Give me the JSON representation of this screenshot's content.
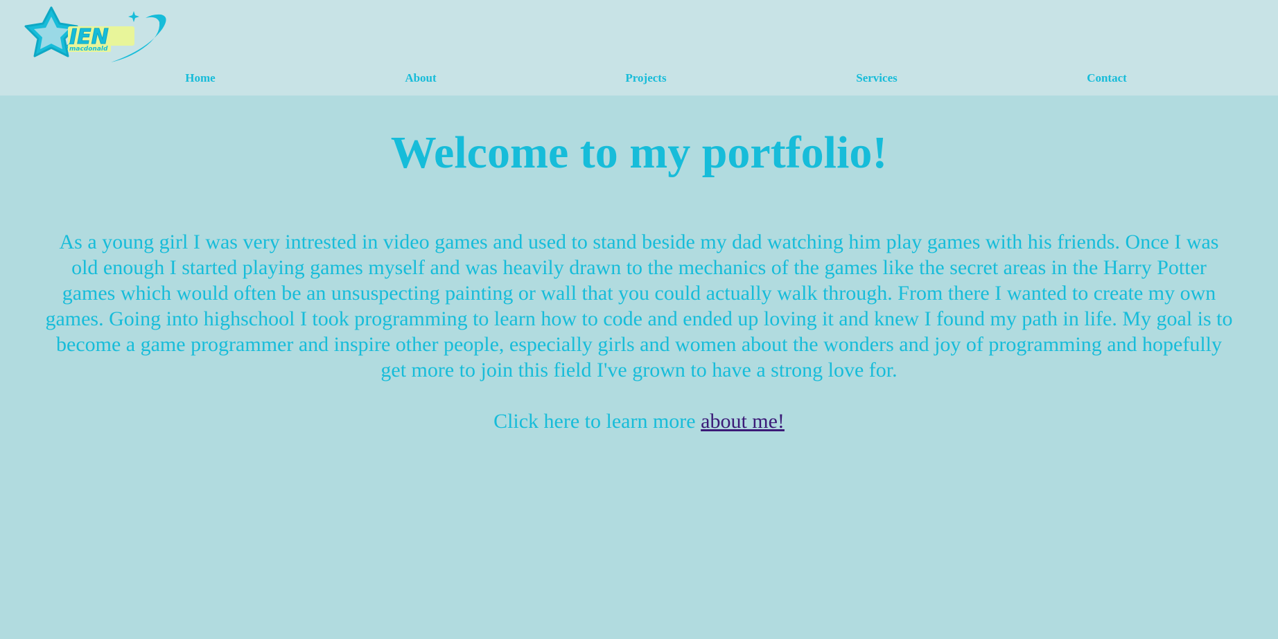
{
  "header": {
    "logo": {
      "main_text": "JEN",
      "sub_text": "macdonald"
    }
  },
  "nav": {
    "items": [
      {
        "label": "Home"
      },
      {
        "label": "About"
      },
      {
        "label": "Projects"
      },
      {
        "label": "Services"
      },
      {
        "label": "Contact"
      }
    ]
  },
  "main": {
    "title": "Welcome to my portfolio!",
    "intro": "As a young girl I was very intrested in video games and used to stand beside my dad watching him play games with his friends. Once I was old enough I started playing games myself and was heavily drawn to the mechanics of the games like the secret areas in the Harry Potter games which would often be an unsuspecting painting or wall that you could actually walk through. From there I wanted to create my own games. Going into highschool I took programming to learn how to code and ended up loving it and knew I found my path in life. My goal is to become a game programmer and inspire other people, especially girls and women about the wonders and joy of programming and hopefully get more to join this field I've grown to have a strong love for.",
    "cta_text": "Click here to learn more ",
    "cta_link": "about me!"
  },
  "colors": {
    "page_background": "#b1dbdf",
    "header_background": "#c8e3e6",
    "accent_cyan": "#17bcd9",
    "link_visited": "#3b1a77",
    "logo_yellow": "#e8f59a"
  },
  "icons": {
    "logo_star": "star-icon",
    "logo_sparkle": "sparkle-icon"
  }
}
